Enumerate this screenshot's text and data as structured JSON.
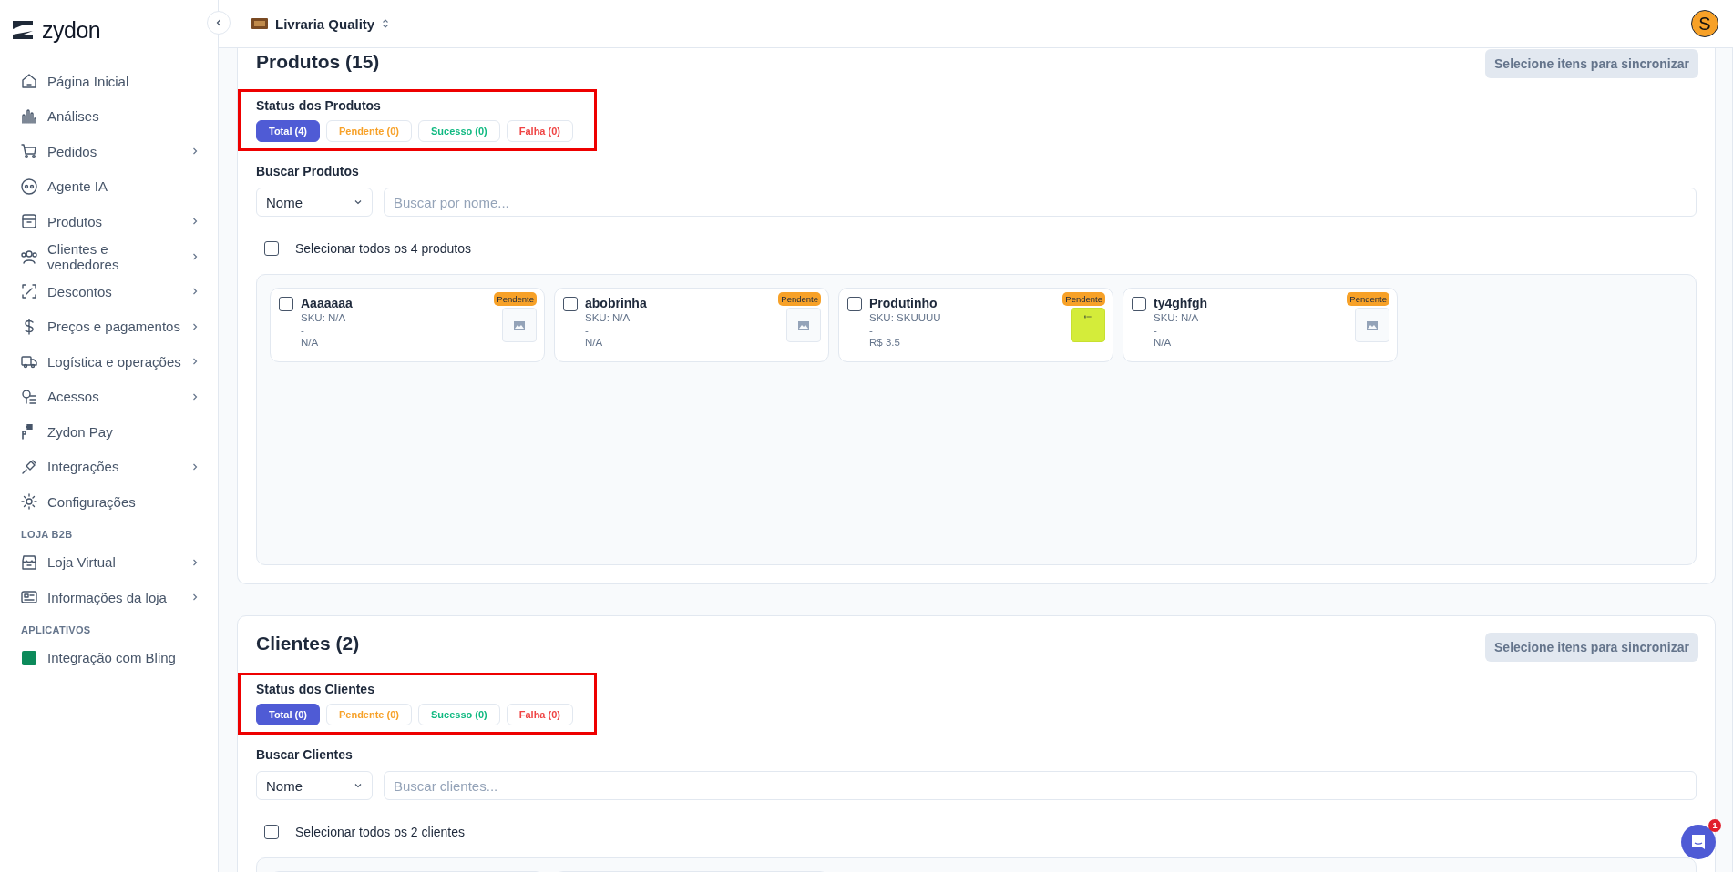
{
  "sidebar": {
    "logo": "zydon",
    "sections": [
      {
        "items": [
          {
            "label": "Página Inicial",
            "expandable": false
          },
          {
            "label": "Análises",
            "expandable": false
          },
          {
            "label": "Pedidos",
            "expandable": true
          },
          {
            "label": "Agente IA",
            "expandable": false
          },
          {
            "label": "Produtos",
            "expandable": true
          },
          {
            "label": "Clientes e vendedores",
            "expandable": true
          },
          {
            "label": "Descontos",
            "expandable": true
          },
          {
            "label": "Preços e pagamentos",
            "expandable": true
          },
          {
            "label": "Logística e operações",
            "expandable": true
          },
          {
            "label": "Acessos",
            "expandable": true
          },
          {
            "label": "Zydon Pay",
            "expandable": false
          },
          {
            "label": "Integrações",
            "expandable": true
          },
          {
            "label": "Configurações",
            "expandable": false
          }
        ]
      },
      {
        "heading": "LOJA B2B",
        "items": [
          {
            "label": "Loja Virtual",
            "expandable": true
          },
          {
            "label": "Informações da loja",
            "expandable": true
          }
        ]
      },
      {
        "heading": "APLICATIVOS",
        "items": [
          {
            "label": "Integração com Bling",
            "expandable": false
          }
        ]
      }
    ]
  },
  "header": {
    "store": "Livraria Quality",
    "avatar": "S"
  },
  "sections": [
    {
      "title": "Produtos (15)",
      "sync_button": "Selecione itens para sincronizar",
      "status_label": "Status dos Produtos",
      "highlighted": true,
      "statuses": [
        {
          "label": "Total (4)",
          "selected": true,
          "color": "#4f5bd5"
        },
        {
          "label": "Pendente (0)",
          "selected": false,
          "color": "#f7a128"
        },
        {
          "label": "Sucesso (0)",
          "selected": false,
          "color": "#10b981"
        },
        {
          "label": "Falha (0)",
          "selected": false,
          "color": "#ef4444"
        }
      ],
      "search_label": "Buscar Produtos",
      "filter": "Nome",
      "placeholder": "Buscar por nome...",
      "select_all": "Selecionar todos os 4 produtos",
      "select_all_checked": false,
      "items": [
        {
          "kind": "product",
          "name": "Aaaaaaa",
          "sku": "SKU: N/A",
          "detail": "-",
          "price": "N/A",
          "badge": "Pendente",
          "checked": false
        },
        {
          "kind": "product",
          "name": "abobrinha",
          "sku": "SKU: N/A",
          "detail": "-",
          "price": "N/A",
          "badge": "Pendente",
          "checked": false
        },
        {
          "kind": "branded",
          "name": "Produtinho",
          "sku": "SKU: SKUUUU",
          "detail": "-",
          "price": "R$ 3.5",
          "badge": "Pendente",
          "checked": false
        },
        {
          "kind": "product",
          "name": "ty4ghfgh",
          "sku": "SKU: N/A",
          "detail": "-",
          "price": "N/A",
          "badge": "Pendente",
          "checked": false
        }
      ]
    },
    {
      "title": "Clientes (2)",
      "sync_button": "Selecione itens para sincronizar",
      "status_label": "Status dos Clientes",
      "highlighted": true,
      "statuses": [
        {
          "label": "Total (0)",
          "selected": true,
          "color": "#4f5bd5"
        },
        {
          "label": "Pendente (0)",
          "selected": false,
          "color": "#f7a128"
        },
        {
          "label": "Sucesso (0)",
          "selected": false,
          "color": "#10b981"
        },
        {
          "label": "Falha (0)",
          "selected": false,
          "color": "#ef4444"
        }
      ],
      "search_label": "Buscar Clientes",
      "filter": "Nome",
      "placeholder": "Buscar clientes...",
      "select_all": "Selecionar todos os 2 clientes",
      "select_all_checked": false,
      "items": [
        {
          "kind": "cut"
        },
        {
          "kind": "cut"
        }
      ]
    }
  ],
  "chat": {
    "badge": "1"
  }
}
